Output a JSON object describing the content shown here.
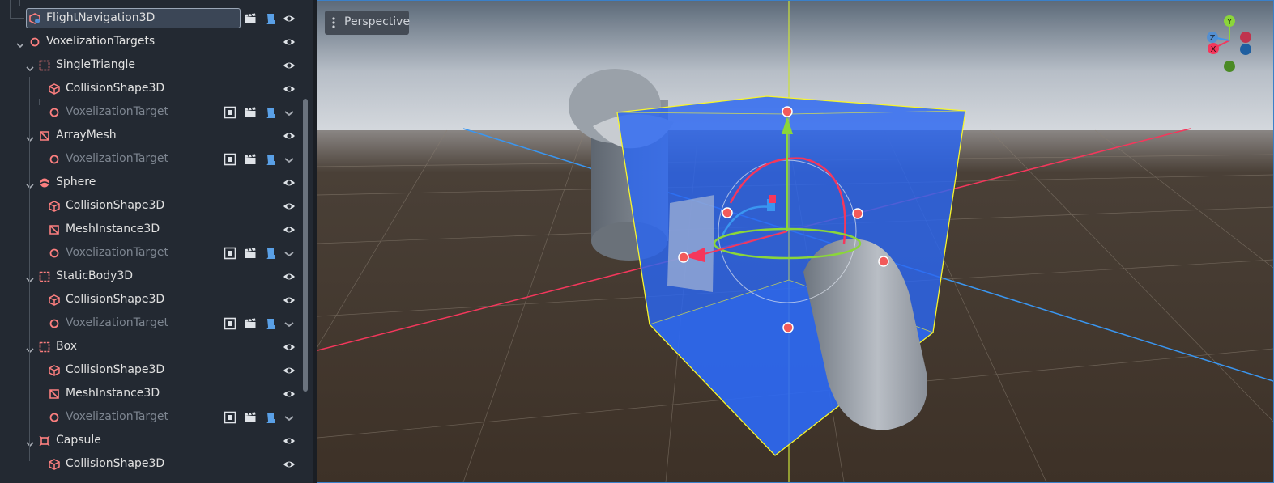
{
  "scene_tree": {
    "items": [
      {
        "label": "FlightNavigation3D",
        "icon": "navigation-3d-icon",
        "selected": true,
        "dim": false,
        "buttons": [
          "clapper-icon",
          "script-icon",
          "visibility-eye-icon"
        ]
      },
      {
        "label": "VoxelizationTargets",
        "icon": "node3d-icon",
        "dim": false,
        "buttons": [
          "visibility-eye-icon"
        ]
      },
      {
        "label": "SingleTriangle",
        "icon": "static-body-icon",
        "dim": false,
        "buttons": [
          "visibility-eye-icon"
        ]
      },
      {
        "label": "CollisionShape3D",
        "icon": "collision-shape-icon",
        "dim": false,
        "buttons": [
          "visibility-eye-icon"
        ]
      },
      {
        "label": "VoxelizationTarget",
        "icon": "node3d-icon",
        "dim": true,
        "buttons": [
          "editable-children-icon",
          "clapper-icon",
          "script-icon",
          "chevron-down-icon"
        ]
      },
      {
        "label": "ArrayMesh",
        "icon": "mesh-instance-icon",
        "dim": false,
        "buttons": [
          "visibility-eye-icon"
        ]
      },
      {
        "label": "VoxelizationTarget",
        "icon": "node3d-icon",
        "dim": true,
        "buttons": [
          "editable-children-icon",
          "clapper-icon",
          "script-icon",
          "chevron-down-icon"
        ]
      },
      {
        "label": "Sphere",
        "icon": "sphere-icon",
        "dim": false,
        "buttons": [
          "visibility-eye-icon"
        ]
      },
      {
        "label": "CollisionShape3D",
        "icon": "collision-shape-icon",
        "dim": false,
        "buttons": [
          "visibility-eye-icon"
        ]
      },
      {
        "label": "MeshInstance3D",
        "icon": "mesh-instance-icon",
        "dim": false,
        "buttons": [
          "visibility-eye-icon"
        ]
      },
      {
        "label": "VoxelizationTarget",
        "icon": "node3d-icon",
        "dim": true,
        "buttons": [
          "editable-children-icon",
          "clapper-icon",
          "script-icon",
          "chevron-down-icon"
        ]
      },
      {
        "label": "StaticBody3D",
        "icon": "static-body-icon",
        "dim": false,
        "buttons": [
          "visibility-eye-icon"
        ]
      },
      {
        "label": "CollisionShape3D",
        "icon": "collision-shape-icon",
        "dim": false,
        "buttons": [
          "visibility-eye-icon"
        ]
      },
      {
        "label": "VoxelizationTarget",
        "icon": "node3d-icon",
        "dim": true,
        "buttons": [
          "editable-children-icon",
          "clapper-icon",
          "script-icon",
          "chevron-down-icon"
        ]
      },
      {
        "label": "Box",
        "icon": "static-body-icon",
        "dim": false,
        "buttons": [
          "visibility-eye-icon"
        ]
      },
      {
        "label": "CollisionShape3D",
        "icon": "collision-shape-icon",
        "dim": false,
        "buttons": [
          "visibility-eye-icon"
        ]
      },
      {
        "label": "MeshInstance3D",
        "icon": "mesh-instance-icon",
        "dim": false,
        "buttons": [
          "visibility-eye-icon"
        ]
      },
      {
        "label": "VoxelizationTarget",
        "icon": "node3d-icon",
        "dim": true,
        "buttons": [
          "editable-children-icon",
          "clapper-icon",
          "script-icon",
          "chevron-down-icon"
        ]
      },
      {
        "label": "Capsule",
        "icon": "capsule-body-icon",
        "dim": false,
        "buttons": [
          "visibility-eye-icon"
        ]
      },
      {
        "label": "CollisionShape3D",
        "icon": "collision-shape-icon",
        "dim": false,
        "buttons": [
          "visibility-eye-icon"
        ]
      }
    ]
  },
  "viewport": {
    "view_mode_label": "Perspective",
    "gizmo_axes": {
      "x": "X",
      "y": "Y",
      "z": "Z"
    }
  },
  "colors": {
    "accent": "#3a80c9",
    "node_icon": "#fc7f7f",
    "x_axis": "#f5375c",
    "y_axis": "#8bd63a",
    "z_axis": "#3a96f0",
    "aabb_yellow": "#f7f52d",
    "box_fill": "#2b66f2"
  }
}
